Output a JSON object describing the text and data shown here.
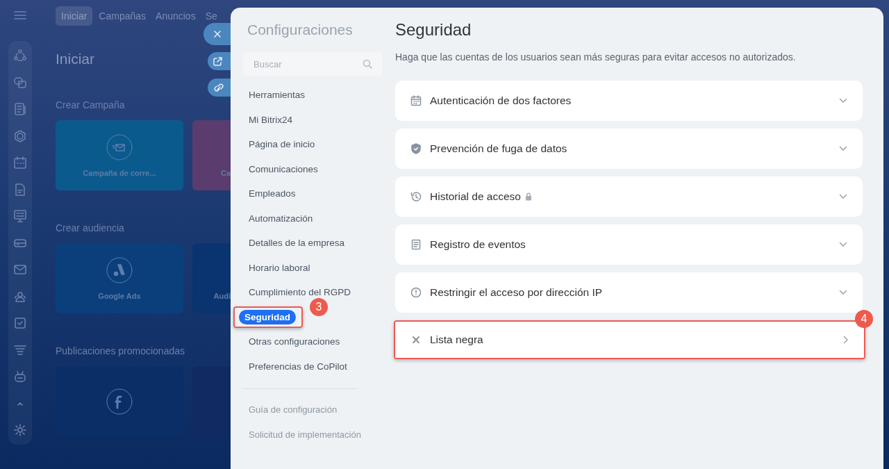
{
  "background_app": {
    "top_tabs": [
      {
        "label": "Iniciar",
        "selected": true
      },
      {
        "label": "Campañas",
        "selected": false
      },
      {
        "label": "Anuncios",
        "selected": false
      },
      {
        "label": "Se",
        "selected": false
      }
    ],
    "page_title": "Iniciar",
    "sections": [
      {
        "title": "Crear Campaña",
        "tiles": [
          {
            "label": "Campaña de corre...",
            "color": "#0b5a8e"
          },
          {
            "label": "Ca",
            "color": "#5a3c6e"
          }
        ]
      },
      {
        "title": "Crear audiencia",
        "tiles": [
          {
            "label": "Google Ads",
            "color": "#0a3f7c"
          },
          {
            "label": "Audi",
            "color": "#0a3470"
          }
        ]
      },
      {
        "title": "Publicaciones promocionadas",
        "tiles": [
          {
            "color": "#0a2f66"
          },
          {
            "color": "#122a62"
          }
        ]
      }
    ]
  },
  "settings": {
    "title": "Configuraciones",
    "search": {
      "placeholder": "Buscar"
    },
    "nav_items": [
      {
        "label": "Herramientas",
        "selected": false
      },
      {
        "label": "Mi Bitrix24",
        "selected": false
      },
      {
        "label": "Página de inicio",
        "selected": false
      },
      {
        "label": "Comunicaciones",
        "selected": false
      },
      {
        "label": "Empleados",
        "selected": false
      },
      {
        "label": "Automatización",
        "selected": false
      },
      {
        "label": "Detalles de la empresa",
        "selected": false
      },
      {
        "label": "Horario laboral",
        "selected": false
      },
      {
        "label": "Cumplimiento del RGPD",
        "selected": false
      },
      {
        "label": "Seguridad",
        "selected": true,
        "callout": "3"
      },
      {
        "label": "Otras configuraciones",
        "selected": false
      },
      {
        "label": "Preferencias de CoPilot",
        "selected": false
      }
    ],
    "footer_links": [
      "Guía de configuración",
      "Solicitud de implementación"
    ],
    "page_title": "Seguridad",
    "description": "Haga que las cuentas de los usuarios sean más seguras para evitar accesos no autorizados.",
    "sections": [
      {
        "label": "Autenticación de dos factores",
        "kind": "accordion",
        "locked": false
      },
      {
        "label": "Prevención de fuga de datos",
        "kind": "accordion",
        "locked": false
      },
      {
        "label": "Historial de acceso",
        "kind": "accordion",
        "locked": true
      },
      {
        "label": "Registro de eventos",
        "kind": "accordion",
        "locked": false
      },
      {
        "label": "Restringir el acceso por dirección IP",
        "kind": "accordion",
        "locked": false
      },
      {
        "label": "Lista negra",
        "kind": "link",
        "locked": false,
        "callout": "4"
      }
    ]
  }
}
